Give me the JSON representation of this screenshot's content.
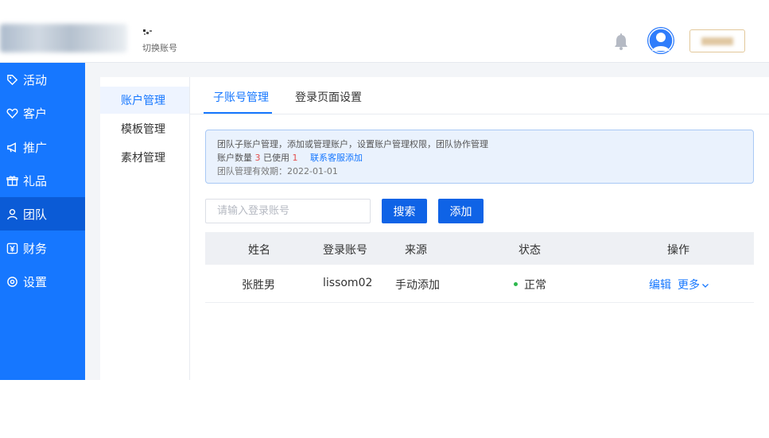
{
  "header": {
    "switch_account": "切换账号",
    "icons": {
      "switch": "switch-account-icon",
      "bell": "bell-icon",
      "avatar": "user-avatar-icon"
    }
  },
  "sidebar": {
    "items": [
      {
        "label": "活动",
        "icon": "tag-icon"
      },
      {
        "label": "客户",
        "icon": "heart-icon"
      },
      {
        "label": "推广",
        "icon": "megaphone-icon"
      },
      {
        "label": "礼品",
        "icon": "gift-icon"
      },
      {
        "label": "团队",
        "icon": "person-icon",
        "active": true
      },
      {
        "label": "财务",
        "icon": "yen-icon"
      },
      {
        "label": "设置",
        "icon": "settings-icon"
      }
    ]
  },
  "submenu": {
    "items": [
      {
        "label": "账户管理",
        "active": true
      },
      {
        "label": "模板管理"
      },
      {
        "label": "素材管理"
      }
    ]
  },
  "tabs": [
    {
      "label": "子账号管理",
      "active": true
    },
    {
      "label": "登录页面设置"
    }
  ],
  "notice": {
    "line1": "团队子账户管理，添加或管理账户，设置账户管理权限，团队协作管理",
    "count_label": "账户数量",
    "count": "3",
    "used_label": "已使用",
    "used": "1",
    "link": "联系客服添加",
    "expire": "团队管理有效期：2022-01-01"
  },
  "search": {
    "placeholder": "请输入登录账号",
    "value": "",
    "search_label": "搜索",
    "add_label": "添加"
  },
  "table": {
    "columns": [
      "姓名",
      "登录账号",
      "来源",
      "状态",
      "操作"
    ],
    "rows": [
      {
        "name": "张胜男",
        "account": "lissom02",
        "source": "手动添加",
        "status": "正常",
        "edit": "编辑",
        "more": "更多"
      }
    ]
  },
  "colors": {
    "primary": "#1677ff",
    "sidebar_active": "#0b5bd6",
    "status_ok": "#2db84d",
    "highlight": "#e34d4d"
  }
}
